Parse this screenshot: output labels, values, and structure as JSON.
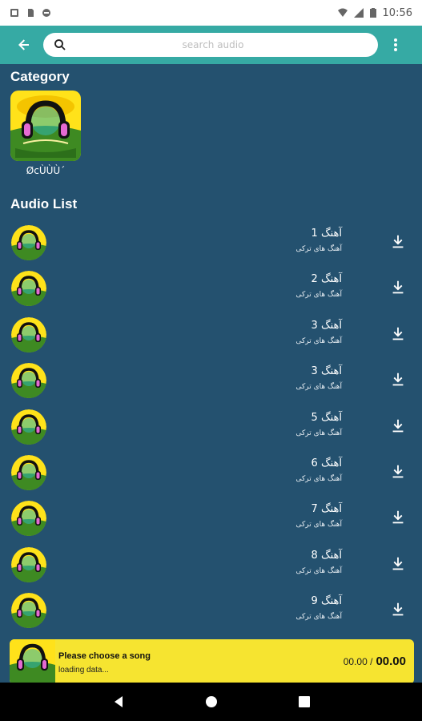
{
  "status_bar": {
    "time": "10:56"
  },
  "search": {
    "placeholder": "search audio"
  },
  "category_section": {
    "title": "Category",
    "items": [
      {
        "label": "ØcÙÙÙ´"
      }
    ]
  },
  "audio_section": {
    "title": "Audio List",
    "items": [
      {
        "title": "آهنگ 1",
        "subtitle": "آهنگ های ترکی"
      },
      {
        "title": "آهنگ 2",
        "subtitle": "آهنگ های ترکی"
      },
      {
        "title": "آهنگ 3",
        "subtitle": "آهنگ های ترکی"
      },
      {
        "title": "آهنگ 3",
        "subtitle": "آهنگ های ترکی"
      },
      {
        "title": "آهنگ 5",
        "subtitle": "آهنگ های ترکی"
      },
      {
        "title": "آهنگ 6",
        "subtitle": "آهنگ های ترکی"
      },
      {
        "title": "آهنگ 7",
        "subtitle": "آهنگ های ترکی"
      },
      {
        "title": "آهنگ 8",
        "subtitle": "آهنگ های ترکی"
      },
      {
        "title": "آهنگ 9",
        "subtitle": "آهنگ های ترکی"
      }
    ]
  },
  "player": {
    "title": "Please choose a song",
    "status": "loading data...",
    "current_time": "00.00 /",
    "duration": "00.00"
  },
  "colors": {
    "background": "#24516f",
    "appbar": "#36aaa4",
    "player": "#f6e430"
  },
  "icons": [
    "back-arrow-icon",
    "search-icon",
    "more-vert-icon",
    "download-icon",
    "nav-back-icon",
    "nav-home-icon",
    "nav-recents-icon"
  ]
}
